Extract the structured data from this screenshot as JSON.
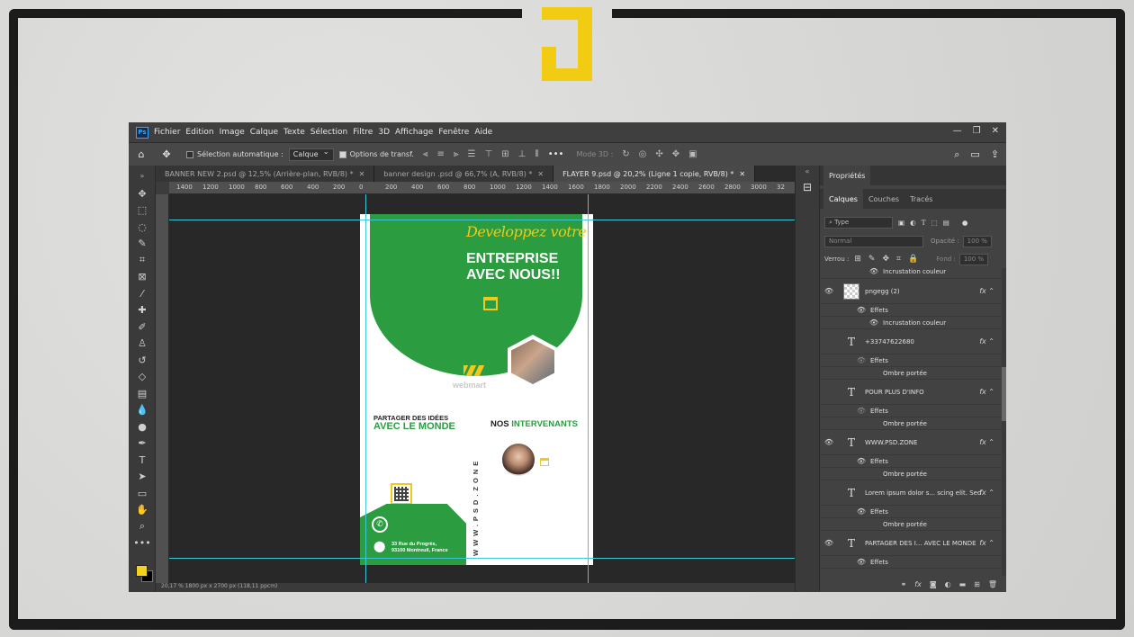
{
  "menu": [
    "Fichier",
    "Edition",
    "Image",
    "Calque",
    "Texte",
    "Sélection",
    "Filtre",
    "3D",
    "Affichage",
    "Fenêtre",
    "Aide"
  ],
  "options": {
    "auto_select_label": "Sélection automatique :",
    "auto_select_value": "Calque",
    "transform_label": "Options de transf.",
    "mode3d_label": "Mode 3D :"
  },
  "tabs": [
    {
      "label": "BANNER NEW 2.psd @ 12,5% (Arrière-plan, RVB/8) *"
    },
    {
      "label": "banner design .psd @ 66,7% (A, RVB/8) *"
    },
    {
      "label": "FLAYER 9.psd @ 20,2% (Ligne 1 copie, RVB/8) *"
    }
  ],
  "ruler_labels": [
    "1400",
    "1200",
    "1000",
    "800",
    "600",
    "400",
    "200",
    "0",
    "200",
    "400",
    "600",
    "800",
    "1000",
    "1200",
    "1400",
    "1600",
    "1800",
    "2000",
    "2200",
    "2400",
    "2600",
    "2800",
    "3000",
    "32"
  ],
  "flyer": {
    "script_title": "Developpez votre",
    "title_line1": "ENTREPRISE",
    "title_line2": "AVEC NOUS!!",
    "brand": "webmart",
    "partager": "PARTAGER DES IDÉES",
    "avec_monde": "AVEC LE MONDE",
    "nos": "NOS",
    "intervenants": "INTERVENANTS",
    "vertical_url": "WWW.PSD.ZONE",
    "address_line1": "33 Rue du Progrès,",
    "address_line2": "93100 Montreuil, France"
  },
  "status": "20,17 %    1800 px x 2700 px (118,11 ppcm)",
  "panel": {
    "properties_tab": "Propriétés",
    "tabs": [
      "Calques",
      "Couches",
      "Tracés"
    ],
    "filter_type": "Type",
    "blend_mode": "Normal",
    "opacity_label": "Opacité :",
    "opacity_value": "100 %",
    "lock_label": "Verrou :",
    "fill_label": "Fond :",
    "fill_value": "100 %",
    "effects_label": "Effets",
    "incrustation": "Incrustation couleur",
    "ombre": "Ombre portée",
    "layers": [
      {
        "name": "pngegg (2)"
      },
      {
        "name": "+33747622680"
      },
      {
        "name": "POUR PLUS D'INFO"
      },
      {
        "name": "WWW.PSD.ZONE"
      },
      {
        "name": "Lorem ipsum dolor s... scing elit.  Sed"
      },
      {
        "name": "PARTAGER DES I... AVEC LE MONDE"
      }
    ]
  },
  "colors": {
    "green": "#2b9c3f",
    "yellow": "#f2c81a",
    "foreground": "#f2d21a"
  }
}
